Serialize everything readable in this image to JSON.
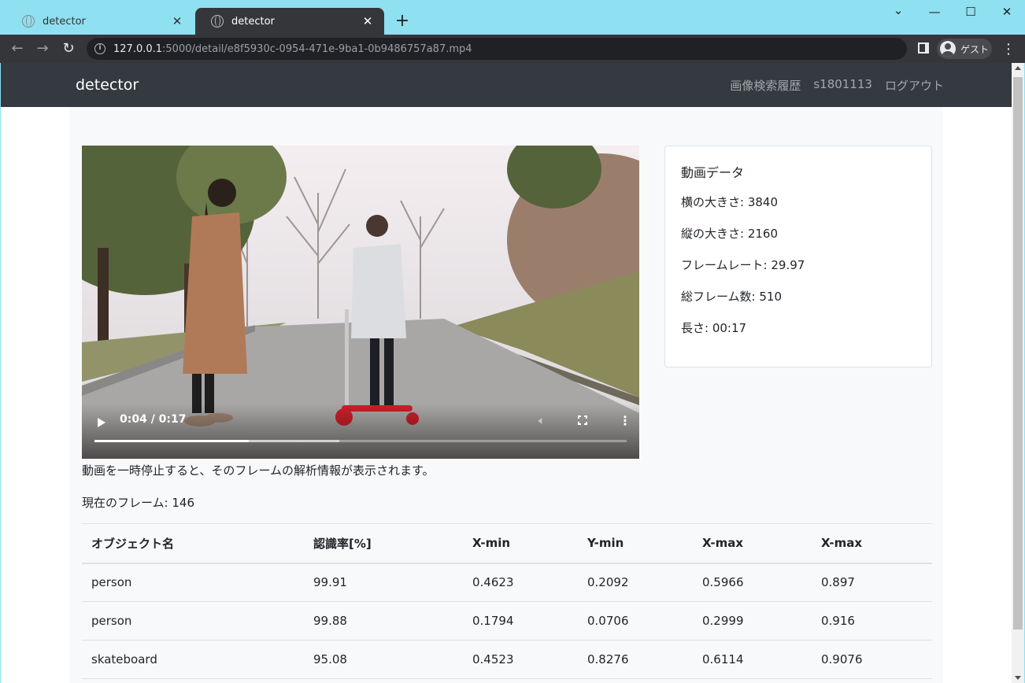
{
  "browser": {
    "tabs": [
      {
        "title": "detector",
        "active": false
      },
      {
        "title": "detector",
        "active": true
      }
    ],
    "new_tab": "+",
    "url_host": "127.0.0.1",
    "url_rest": ":5000/detail/e8f5930c-0954-471e-9ba1-0b9486757a87.mp4",
    "profile_label": "ゲスト",
    "window_controls": {
      "minimize": "—",
      "maximize": "☐",
      "close": "✕",
      "chevron": "⌄"
    }
  },
  "navbar": {
    "brand": "detector",
    "links": [
      "画像検索履歴",
      "s1801113",
      "ログアウト"
    ]
  },
  "video": {
    "time": "0:04 / 0:17",
    "played_fraction": 0.29,
    "buffered_fraction": 0.46
  },
  "video_info": {
    "title": "動画データ",
    "width": "横の大きさ: 3840",
    "height": "縦の大きさ: 2160",
    "framerate": "フレームレート: 29.97",
    "frames": "総フレーム数: 510",
    "length": "長さ: 00:17"
  },
  "note": "動画を一時停止すると、そのフレームの解析情報が表示されます。",
  "current_frame": "現在のフレーム: 146",
  "table": {
    "headers": [
      "オブジェクト名",
      "認識率[%]",
      "X-min",
      "Y-min",
      "X-max",
      "X-max"
    ],
    "rows": [
      [
        "person",
        "99.91",
        "0.4623",
        "0.2092",
        "0.5966",
        "0.897"
      ],
      [
        "person",
        "99.88",
        "0.1794",
        "0.0706",
        "0.2999",
        "0.916"
      ],
      [
        "skateboard",
        "95.08",
        "0.4523",
        "0.8276",
        "0.6114",
        "0.9076"
      ]
    ]
  }
}
